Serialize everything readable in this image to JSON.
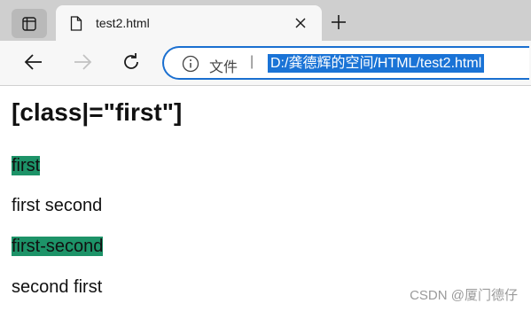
{
  "tab": {
    "title": "test2.html"
  },
  "addressbar": {
    "info_label": "文件",
    "separator": "|",
    "url": "D:/龚德辉的空间/HTML/test2.html"
  },
  "page": {
    "heading": "[class|=\"first\"]",
    "paragraphs": [
      {
        "text": "first",
        "highlighted": true
      },
      {
        "text": "first second",
        "highlighted": false
      },
      {
        "text": "first-second",
        "highlighted": true
      },
      {
        "text": "second first",
        "highlighted": false
      }
    ]
  },
  "watermark": "CSDN @厦门德仔",
  "colors": {
    "highlight": "#1d9368",
    "url_selection": "#1a73d6"
  },
  "icons": [
    "tab-actions-icon",
    "file-icon",
    "close-icon",
    "plus-icon",
    "back-icon",
    "forward-icon",
    "refresh-icon",
    "info-icon"
  ]
}
